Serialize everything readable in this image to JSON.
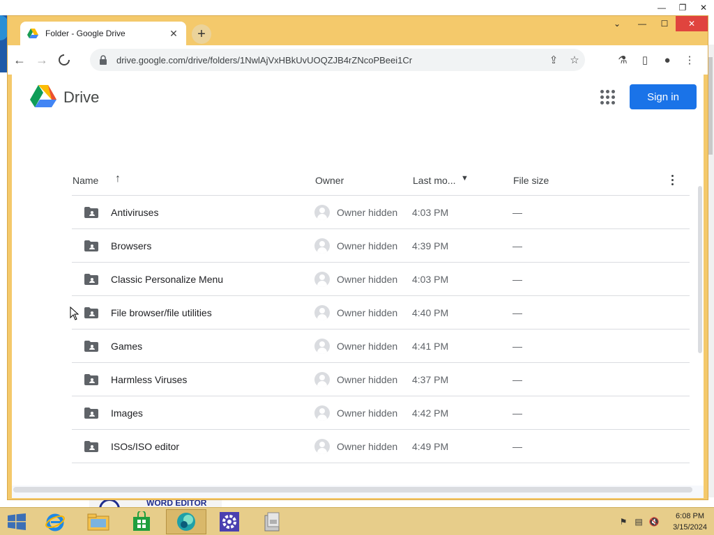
{
  "browser": {
    "tab_title": "Folder - Google Drive",
    "url": "drive.google.com/drive/folders/1NwlAjVxHBkUvUOQZJB4rZNcoPBeei1Cr"
  },
  "drive": {
    "brand": "Drive",
    "sign_in_label": "Sign in"
  },
  "list": {
    "columns": {
      "name": "Name",
      "owner": "Owner",
      "modified": "Last mo...",
      "size": "File size"
    },
    "rows": [
      {
        "name": "Antiviruses",
        "owner": "Owner hidden",
        "time": "4:03 PM",
        "size": "—"
      },
      {
        "name": "Browsers",
        "owner": "Owner hidden",
        "time": "4:39 PM",
        "size": "—"
      },
      {
        "name": "Classic Personalize Menu",
        "owner": "Owner hidden",
        "time": "4:03 PM",
        "size": "—"
      },
      {
        "name": "File browser/file utilities",
        "owner": "Owner hidden",
        "time": "4:40 PM",
        "size": "—"
      },
      {
        "name": "Games",
        "owner": "Owner hidden",
        "time": "4:41 PM",
        "size": "—"
      },
      {
        "name": "Harmless Viruses",
        "owner": "Owner hidden",
        "time": "4:37 PM",
        "size": "—"
      },
      {
        "name": "Images",
        "owner": "Owner hidden",
        "time": "4:42 PM",
        "size": "—"
      },
      {
        "name": "ISOs/ISO editor",
        "owner": "Owner hidden",
        "time": "4:49 PM",
        "size": "—"
      }
    ]
  },
  "background": {
    "word_editor_label": "WORD EDITOR"
  },
  "taskbar": {
    "time": "6:08 PM",
    "date": "3/15/2024"
  },
  "colors": {
    "window_frame": "#f4c96b",
    "taskbar": "#e7cd8a",
    "accent_blue": "#1a73e8",
    "close_red": "#e0443e"
  }
}
